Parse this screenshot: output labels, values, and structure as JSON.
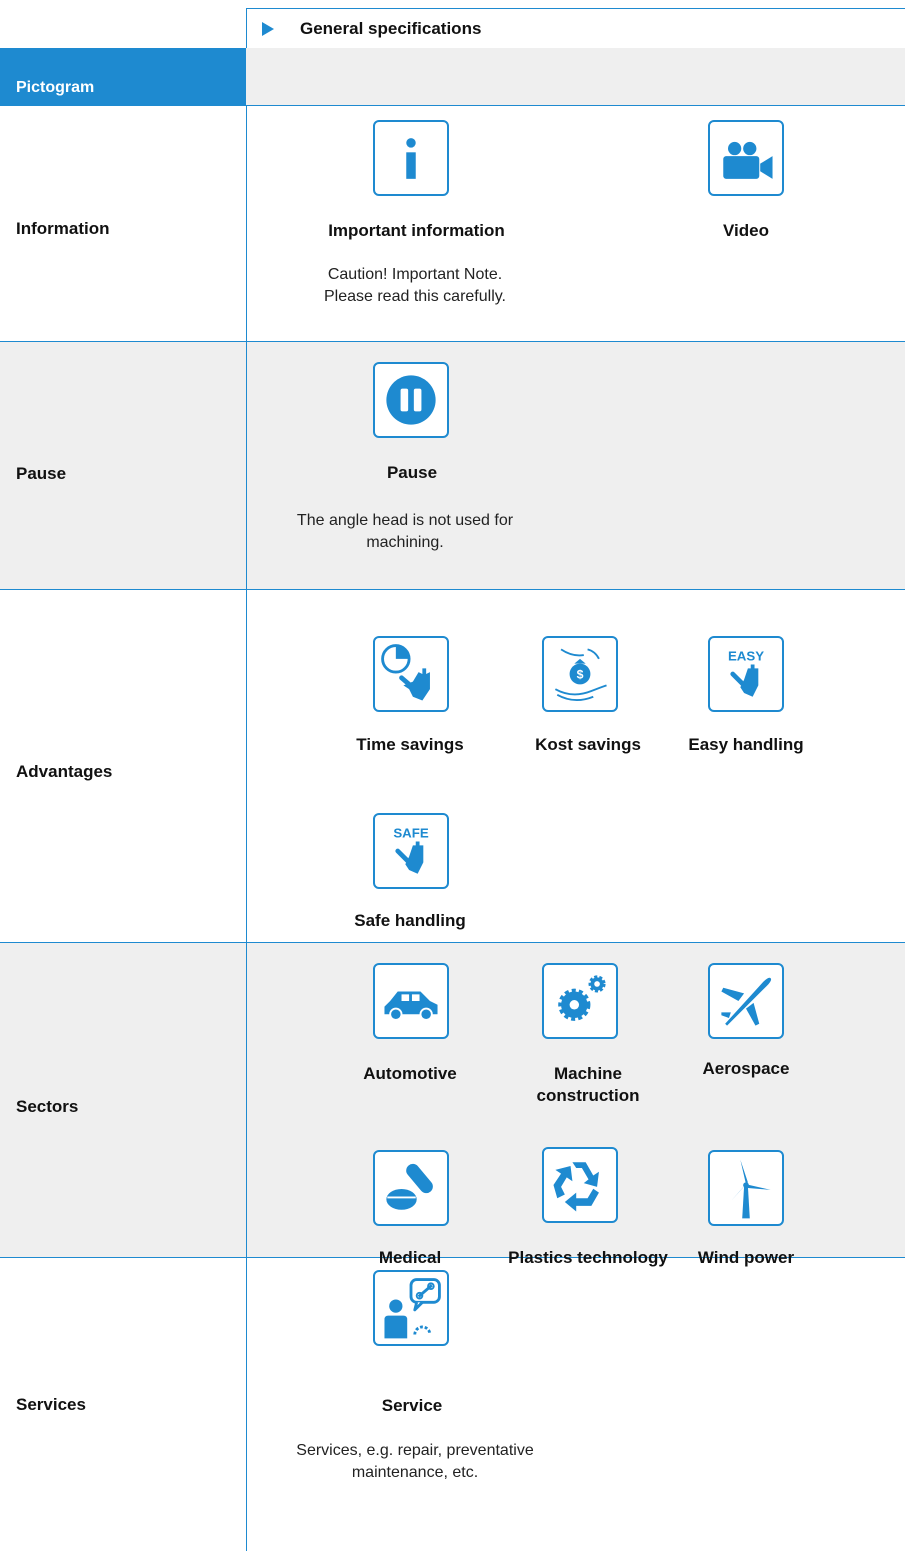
{
  "header": {
    "title": "General specifications"
  },
  "column_header": "Pictogram",
  "colors": {
    "accent": "#1e8ad0",
    "band": "#efefef"
  },
  "rows": [
    {
      "label": "Information",
      "items": [
        {
          "icon": "info-icon",
          "caption": "Important information",
          "description": [
            "Caution! Important Note.",
            "Please read this carefully."
          ]
        },
        {
          "icon": "video-camera-icon",
          "caption": "Video"
        }
      ]
    },
    {
      "label": "Pause",
      "items": [
        {
          "icon": "pause-icon",
          "caption": "Pause",
          "description": [
            "The angle head is not used for",
            "machining."
          ]
        }
      ]
    },
    {
      "label": "Advantages",
      "items": [
        {
          "icon": "time-savings-icon",
          "caption": "Time savings"
        },
        {
          "icon": "cost-savings-icon",
          "caption": "Kost savings"
        },
        {
          "icon": "easy-handling-icon",
          "caption": "Easy handling",
          "badge": "EASY"
        },
        {
          "icon": "safe-handling-icon",
          "caption": "Safe handling",
          "badge": "SAFE"
        }
      ]
    },
    {
      "label": "Sectors",
      "items": [
        {
          "icon": "car-icon",
          "caption": "Automotive"
        },
        {
          "icon": "gears-icon",
          "caption": [
            "Machine",
            "construction"
          ]
        },
        {
          "icon": "airplane-icon",
          "caption": "Aerospace"
        },
        {
          "icon": "pills-icon",
          "caption": "Medical"
        },
        {
          "icon": "recycle-icon",
          "caption": "Plastics technology"
        },
        {
          "icon": "wind-turbine-icon",
          "caption": "Wind power"
        }
      ]
    },
    {
      "label": "Services",
      "items": [
        {
          "icon": "service-icon",
          "caption": "Service",
          "description": [
            "Services, e.g. repair, preventative",
            "maintenance, etc."
          ]
        }
      ]
    }
  ]
}
